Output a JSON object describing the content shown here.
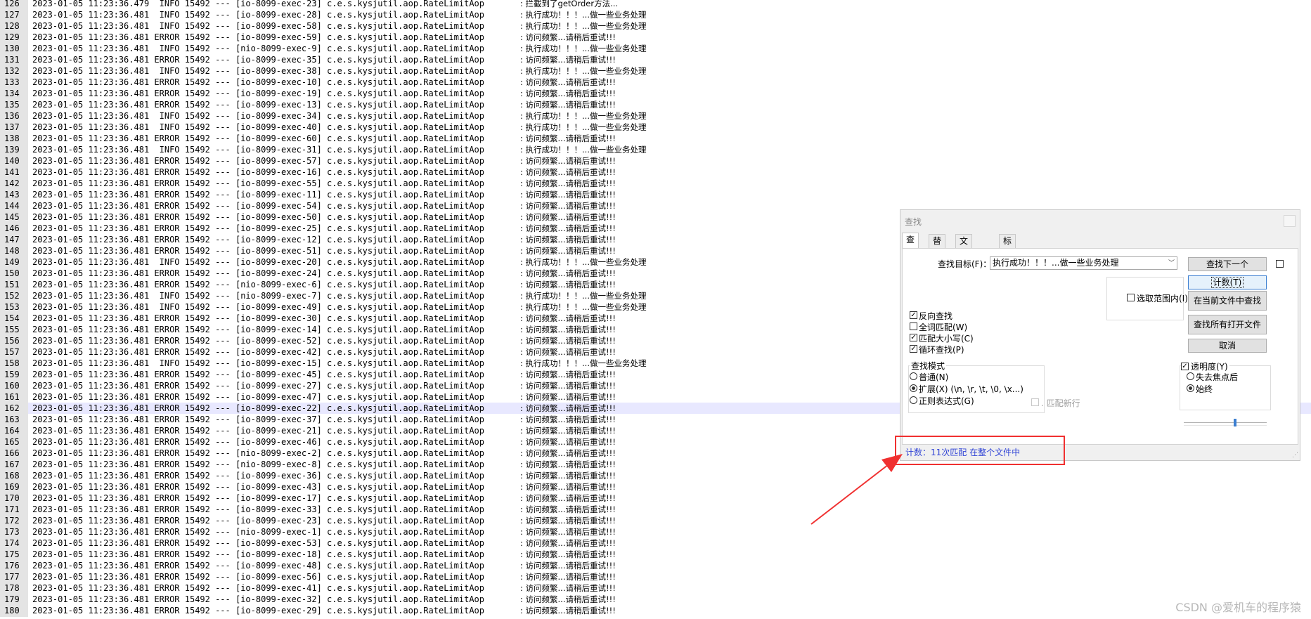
{
  "editor": {
    "first_line": 126,
    "current_line": 162,
    "timestamp_date": "2023-01-05",
    "pid": "15492",
    "logger": "c.e.s.kysjutil.aop.RateLimitAop",
    "messages": {
      "intercept": ": 拦截到了getOrder方法...",
      "info": ": 执行成功！！！...做一些业务处理",
      "error": ": 访问频繁...请稍后重试!!!"
    },
    "lines": [
      [
        "11:23:36.479",
        "INFO",
        "io-8099-exec-23",
        "intercept"
      ],
      [
        "11:23:36.481",
        "INFO",
        "io-8099-exec-28",
        "info"
      ],
      [
        "11:23:36.481",
        "INFO",
        "io-8099-exec-58",
        "info"
      ],
      [
        "11:23:36.481",
        "ERROR",
        "io-8099-exec-59",
        "error"
      ],
      [
        "11:23:36.481",
        "INFO",
        "nio-8099-exec-9",
        "info"
      ],
      [
        "11:23:36.481",
        "ERROR",
        "io-8099-exec-35",
        "error"
      ],
      [
        "11:23:36.481",
        "INFO",
        "io-8099-exec-38",
        "info"
      ],
      [
        "11:23:36.481",
        "ERROR",
        "io-8099-exec-10",
        "error"
      ],
      [
        "11:23:36.481",
        "ERROR",
        "io-8099-exec-19",
        "error"
      ],
      [
        "11:23:36.481",
        "ERROR",
        "io-8099-exec-13",
        "error"
      ],
      [
        "11:23:36.481",
        "INFO",
        "io-8099-exec-34",
        "info"
      ],
      [
        "11:23:36.481",
        "INFO",
        "io-8099-exec-40",
        "info"
      ],
      [
        "11:23:36.481",
        "ERROR",
        "io-8099-exec-60",
        "error"
      ],
      [
        "11:23:36.481",
        "INFO",
        "io-8099-exec-31",
        "info"
      ],
      [
        "11:23:36.481",
        "ERROR",
        "io-8099-exec-57",
        "error"
      ],
      [
        "11:23:36.481",
        "ERROR",
        "io-8099-exec-16",
        "error"
      ],
      [
        "11:23:36.481",
        "ERROR",
        "io-8099-exec-55",
        "error"
      ],
      [
        "11:23:36.481",
        "ERROR",
        "io-8099-exec-11",
        "error"
      ],
      [
        "11:23:36.481",
        "ERROR",
        "io-8099-exec-54",
        "error"
      ],
      [
        "11:23:36.481",
        "ERROR",
        "io-8099-exec-50",
        "error"
      ],
      [
        "11:23:36.481",
        "ERROR",
        "io-8099-exec-25",
        "error"
      ],
      [
        "11:23:36.481",
        "ERROR",
        "io-8099-exec-12",
        "error"
      ],
      [
        "11:23:36.481",
        "ERROR",
        "io-8099-exec-51",
        "error"
      ],
      [
        "11:23:36.481",
        "INFO",
        "io-8099-exec-20",
        "info"
      ],
      [
        "11:23:36.481",
        "ERROR",
        "io-8099-exec-24",
        "error"
      ],
      [
        "11:23:36.481",
        "ERROR",
        "nio-8099-exec-6",
        "error"
      ],
      [
        "11:23:36.481",
        "INFO",
        "nio-8099-exec-7",
        "info"
      ],
      [
        "11:23:36.481",
        "INFO",
        "io-8099-exec-49",
        "info"
      ],
      [
        "11:23:36.481",
        "ERROR",
        "io-8099-exec-30",
        "error"
      ],
      [
        "11:23:36.481",
        "ERROR",
        "io-8099-exec-14",
        "error"
      ],
      [
        "11:23:36.481",
        "ERROR",
        "io-8099-exec-52",
        "error"
      ],
      [
        "11:23:36.481",
        "ERROR",
        "io-8099-exec-42",
        "error"
      ],
      [
        "11:23:36.481",
        "INFO",
        "io-8099-exec-15",
        "info"
      ],
      [
        "11:23:36.481",
        "ERROR",
        "io-8099-exec-45",
        "error"
      ],
      [
        "11:23:36.481",
        "ERROR",
        "io-8099-exec-27",
        "error"
      ],
      [
        "11:23:36.481",
        "ERROR",
        "io-8099-exec-47",
        "error"
      ],
      [
        "11:23:36.481",
        "ERROR",
        "io-8099-exec-22",
        "error"
      ],
      [
        "11:23:36.481",
        "ERROR",
        "io-8099-exec-37",
        "error"
      ],
      [
        "11:23:36.481",
        "ERROR",
        "io-8099-exec-21",
        "error"
      ],
      [
        "11:23:36.481",
        "ERROR",
        "io-8099-exec-46",
        "error"
      ],
      [
        "11:23:36.481",
        "ERROR",
        "nio-8099-exec-2",
        "error"
      ],
      [
        "11:23:36.481",
        "ERROR",
        "nio-8099-exec-8",
        "error"
      ],
      [
        "11:23:36.481",
        "ERROR",
        "io-8099-exec-36",
        "error"
      ],
      [
        "11:23:36.481",
        "ERROR",
        "io-8099-exec-43",
        "error"
      ],
      [
        "11:23:36.481",
        "ERROR",
        "io-8099-exec-17",
        "error"
      ],
      [
        "11:23:36.481",
        "ERROR",
        "io-8099-exec-33",
        "error"
      ],
      [
        "11:23:36.481",
        "ERROR",
        "io-8099-exec-23",
        "error"
      ],
      [
        "11:23:36.481",
        "ERROR",
        "nio-8099-exec-1",
        "error"
      ],
      [
        "11:23:36.481",
        "ERROR",
        "io-8099-exec-53",
        "error"
      ],
      [
        "11:23:36.481",
        "ERROR",
        "io-8099-exec-18",
        "error"
      ],
      [
        "11:23:36.481",
        "ERROR",
        "io-8099-exec-48",
        "error"
      ],
      [
        "11:23:36.481",
        "ERROR",
        "io-8099-exec-56",
        "error"
      ],
      [
        "11:23:36.481",
        "ERROR",
        "io-8099-exec-41",
        "error"
      ],
      [
        "11:23:36.481",
        "ERROR",
        "io-8099-exec-32",
        "error"
      ],
      [
        "11:23:36.481",
        "ERROR",
        "io-8099-exec-29",
        "error"
      ]
    ]
  },
  "dialog": {
    "title": "查找",
    "tabs": [
      "查找",
      "替换",
      "文件查找",
      "标记"
    ],
    "active_tab": 0,
    "find_label": "查找目标(F)：",
    "find_value": "执行成功！！！...做一些业务处理",
    "buttons": {
      "find_next": "查找下一个",
      "count": "计数(T)",
      "find_in_current": "在当前文件中查找",
      "find_in_all": "查找所有打开文件(O)",
      "cancel": "取消"
    },
    "in_selection": "选取范围内(I)",
    "options": [
      {
        "label": "反向查找",
        "checked": true
      },
      {
        "label": "全词匹配(W)",
        "checked": false
      },
      {
        "label": "匹配大小写(C)",
        "checked": true
      },
      {
        "label": "循环查找(P)",
        "checked": true
      }
    ],
    "search_mode": {
      "title": "查找模式",
      "options": [
        {
          "label": "普通(N)",
          "selected": false
        },
        {
          "label": "扩展(X) (\\n, \\r, \\t, \\0, \\x...)",
          "selected": true
        },
        {
          "label": "正则表达式(G)",
          "selected": false
        }
      ],
      "match_newline": ". 匹配新行"
    },
    "transparency": {
      "title": "透明度(Y)",
      "checked": true,
      "options": [
        {
          "label": "失去焦点后",
          "selected": false
        },
        {
          "label": "始终",
          "selected": true
        }
      ],
      "level": 0.62
    },
    "status": "计数：11次匹配 在整个文件中"
  },
  "annotation": {
    "color": "#f03030"
  },
  "watermark": "CSDN @爱机车的程序猿"
}
